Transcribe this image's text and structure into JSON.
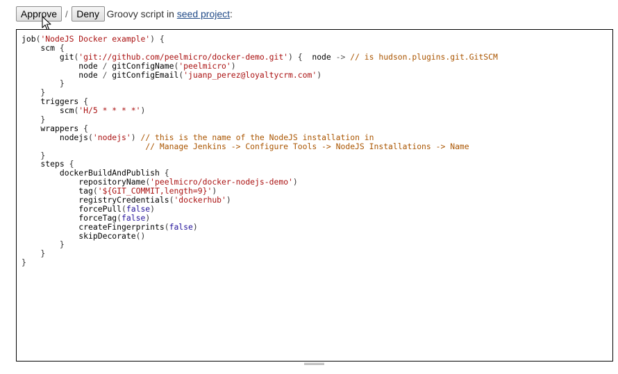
{
  "toolbar": {
    "approve_label": "Approve",
    "separator": "/",
    "deny_label": "Deny",
    "description_prefix": "Groovy script in ",
    "link_label": "seed project",
    "description_suffix": ":"
  },
  "editor": {
    "language": "groovy",
    "lines": [
      [
        {
          "t": "job",
          "c": "plain"
        },
        {
          "t": "(",
          "c": "br"
        },
        {
          "t": "'NodeJS Docker example'",
          "c": "str"
        },
        {
          "t": ") {",
          "c": "br"
        }
      ],
      [
        {
          "t": "    scm ",
          "c": "plain"
        },
        {
          "t": "{",
          "c": "br"
        }
      ],
      [
        {
          "t": "        git",
          "c": "plain"
        },
        {
          "t": "(",
          "c": "br"
        },
        {
          "t": "'git://github.com/peelmicro/docker-demo.git'",
          "c": "str"
        },
        {
          "t": ") {  ",
          "c": "br"
        },
        {
          "t": "node ",
          "c": "plain"
        },
        {
          "t": "->",
          "c": "op"
        },
        {
          "t": " ",
          "c": "plain"
        },
        {
          "t": "// is hudson.plugins.git.GitSCM",
          "c": "cmt"
        }
      ],
      [
        {
          "t": "            node ",
          "c": "plain"
        },
        {
          "t": "/",
          "c": "op"
        },
        {
          "t": " gitConfigName",
          "c": "plain"
        },
        {
          "t": "(",
          "c": "br"
        },
        {
          "t": "'peelmicro'",
          "c": "str"
        },
        {
          "t": ")",
          "c": "br"
        }
      ],
      [
        {
          "t": "            node ",
          "c": "plain"
        },
        {
          "t": "/",
          "c": "op"
        },
        {
          "t": " gitConfigEmail",
          "c": "plain"
        },
        {
          "t": "(",
          "c": "br"
        },
        {
          "t": "'juanp_perez@loyaltycrm.com'",
          "c": "str"
        },
        {
          "t": ")",
          "c": "br"
        }
      ],
      [
        {
          "t": "        }",
          "c": "br"
        }
      ],
      [
        {
          "t": "    }",
          "c": "br"
        }
      ],
      [
        {
          "t": "    triggers ",
          "c": "plain"
        },
        {
          "t": "{",
          "c": "br"
        }
      ],
      [
        {
          "t": "        scm",
          "c": "plain"
        },
        {
          "t": "(",
          "c": "br"
        },
        {
          "t": "'H/5 * * * *'",
          "c": "str"
        },
        {
          "t": ")",
          "c": "br"
        }
      ],
      [
        {
          "t": "    }",
          "c": "br"
        }
      ],
      [
        {
          "t": "    wrappers ",
          "c": "plain"
        },
        {
          "t": "{",
          "c": "br"
        }
      ],
      [
        {
          "t": "        nodejs",
          "c": "plain"
        },
        {
          "t": "(",
          "c": "br"
        },
        {
          "t": "'nodejs'",
          "c": "str"
        },
        {
          "t": ") ",
          "c": "br"
        },
        {
          "t": "// this is the name of the NodeJS installation in",
          "c": "cmt"
        }
      ],
      [
        {
          "t": "                          ",
          "c": "plain"
        },
        {
          "t": "// Manage Jenkins -> Configure Tools -> NodeJS Installations -> Name",
          "c": "cmt"
        }
      ],
      [
        {
          "t": "    }",
          "c": "br"
        }
      ],
      [
        {
          "t": "    steps ",
          "c": "plain"
        },
        {
          "t": "{",
          "c": "br"
        }
      ],
      [
        {
          "t": "        dockerBuildAndPublish ",
          "c": "plain"
        },
        {
          "t": "{",
          "c": "br"
        }
      ],
      [
        {
          "t": "            repositoryName",
          "c": "plain"
        },
        {
          "t": "(",
          "c": "br"
        },
        {
          "t": "'peelmicro/docker-nodejs-demo'",
          "c": "str"
        },
        {
          "t": ")",
          "c": "br"
        }
      ],
      [
        {
          "t": "            tag",
          "c": "plain"
        },
        {
          "t": "(",
          "c": "br"
        },
        {
          "t": "'${GIT_COMMIT,length=9}'",
          "c": "str"
        },
        {
          "t": ")",
          "c": "br"
        }
      ],
      [
        {
          "t": "            registryCredentials",
          "c": "plain"
        },
        {
          "t": "(",
          "c": "br"
        },
        {
          "t": "'dockerhub'",
          "c": "str"
        },
        {
          "t": ")",
          "c": "br"
        }
      ],
      [
        {
          "t": "            forcePull",
          "c": "plain"
        },
        {
          "t": "(",
          "c": "br"
        },
        {
          "t": "false",
          "c": "atom"
        },
        {
          "t": ")",
          "c": "br"
        }
      ],
      [
        {
          "t": "            forceTag",
          "c": "plain"
        },
        {
          "t": "(",
          "c": "br"
        },
        {
          "t": "false",
          "c": "atom"
        },
        {
          "t": ")",
          "c": "br"
        }
      ],
      [
        {
          "t": "            createFingerprints",
          "c": "plain"
        },
        {
          "t": "(",
          "c": "br"
        },
        {
          "t": "false",
          "c": "atom"
        },
        {
          "t": ")",
          "c": "br"
        }
      ],
      [
        {
          "t": "            skipDecorate",
          "c": "plain"
        },
        {
          "t": "()",
          "c": "br"
        }
      ],
      [
        {
          "t": "        }",
          "c": "br"
        }
      ],
      [
        {
          "t": "    }",
          "c": "br"
        }
      ],
      [
        {
          "t": "}",
          "c": "br"
        }
      ]
    ]
  },
  "cursor_icon": "mouse-pointer-icon",
  "resize_icon": "resize-grip-icon",
  "colors": {
    "string": "#a11",
    "comment": "#a50",
    "atom": "#219",
    "link": "#204a87"
  }
}
